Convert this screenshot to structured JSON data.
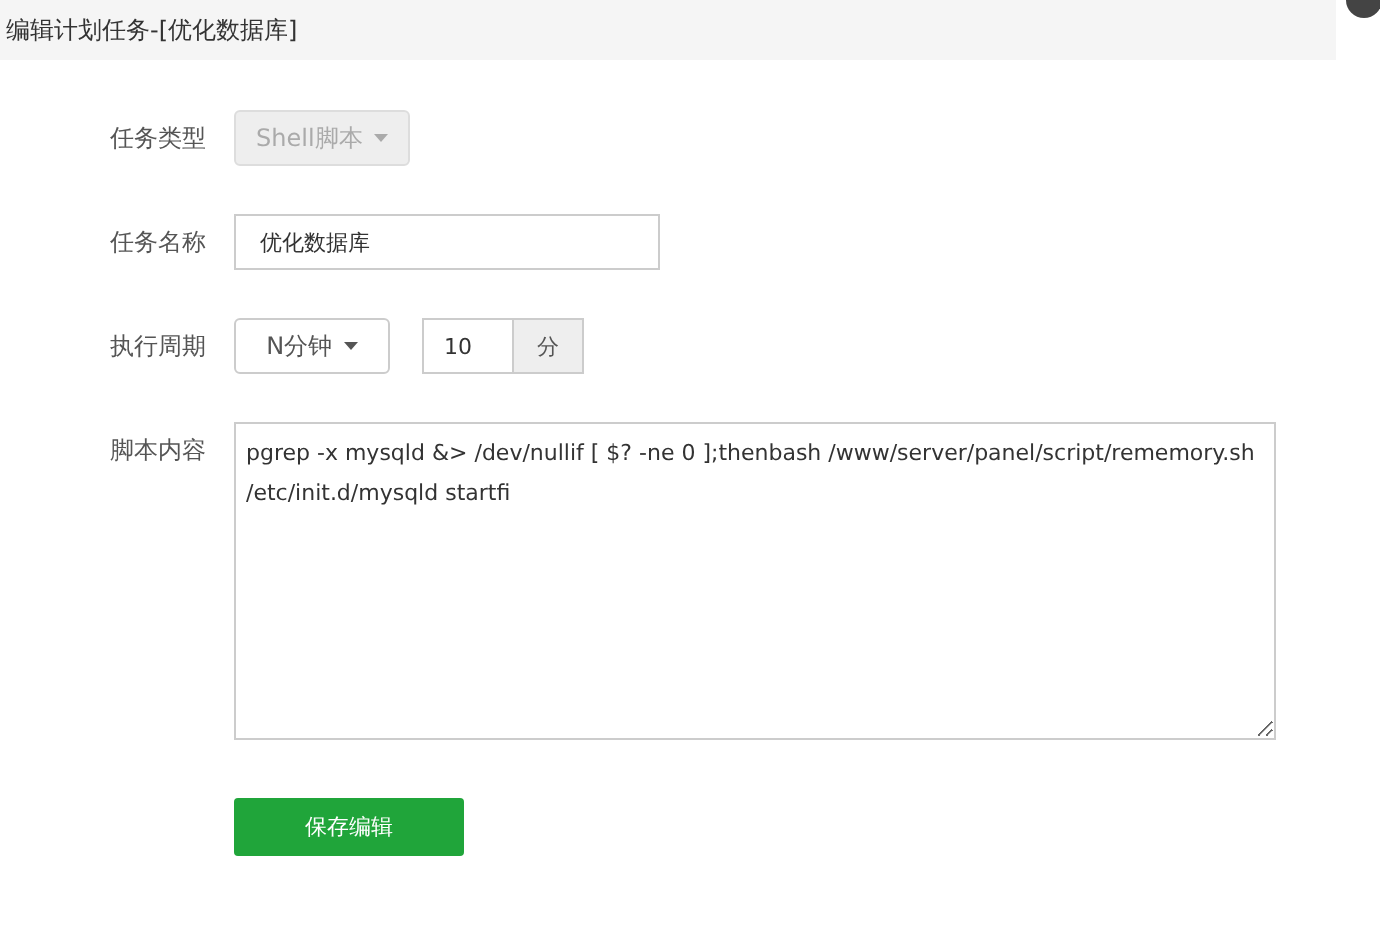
{
  "window": {
    "title": "编辑计划任务-[优化数据库]"
  },
  "form": {
    "task_type": {
      "label": "任务类型",
      "value": "Shell脚本",
      "disabled": true
    },
    "task_name": {
      "label": "任务名称",
      "value": "优化数据库"
    },
    "period": {
      "label": "执行周期",
      "mode": "N分钟",
      "value": "10",
      "unit": "分"
    },
    "script": {
      "label": "脚本内容",
      "value": "pgrep -x mysqld &> /dev/nullif [ $? -ne 0 ];thenbash /www/server/panel/script/rememory.sh\n/etc/init.d/mysqld startfi"
    }
  },
  "buttons": [
    "保存编辑"
  ]
}
